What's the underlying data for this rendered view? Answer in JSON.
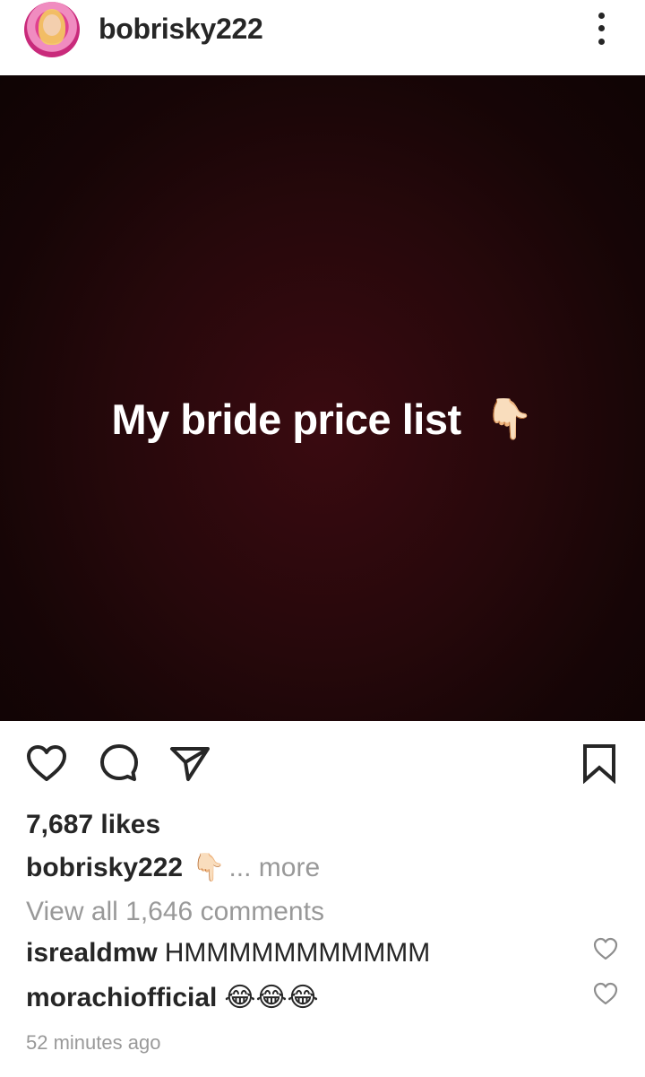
{
  "header": {
    "username": "bobrisky222",
    "more_icon": "more-vertical-icon"
  },
  "post": {
    "image_text": "My bride price list",
    "image_emoji": "👇🏻"
  },
  "actions": {
    "like_icon": "heart-icon",
    "comment_icon": "comment-icon",
    "share_icon": "send-icon",
    "save_icon": "bookmark-icon"
  },
  "likes": "7,687 likes",
  "caption": {
    "username": "bobrisky222",
    "emoji": "👇🏻",
    "more": "... more"
  },
  "view_all_comments": "View all 1,646 comments",
  "comments": [
    {
      "username": "isrealdmw",
      "text": "HMMMMMMMMMMM"
    },
    {
      "username": "morachiofficial",
      "text": "😂😂😂"
    }
  ],
  "timestamp": "52 minutes ago"
}
